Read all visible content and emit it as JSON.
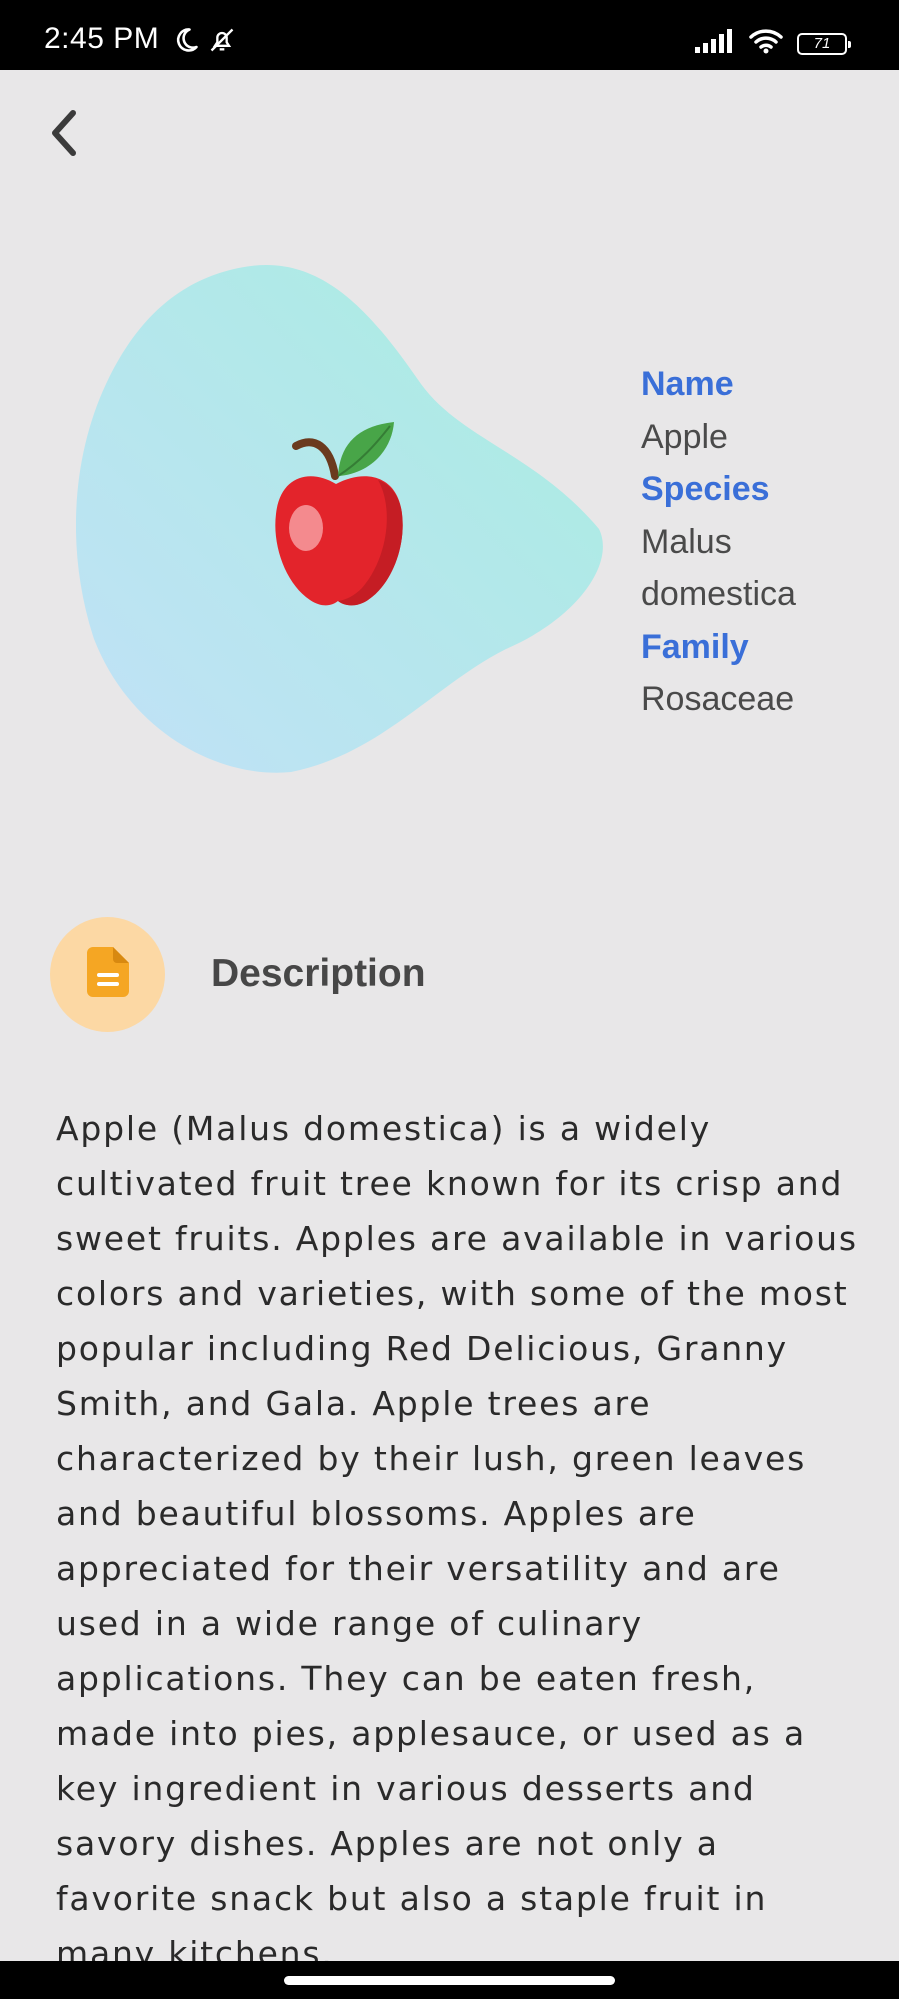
{
  "status_bar": {
    "time": "2:45 PM",
    "battery_level": "71",
    "icons": [
      "moon-icon",
      "bell-off-icon",
      "signal-icon",
      "wifi-icon",
      "battery-icon"
    ]
  },
  "header": {
    "back_icon": "chevron-left-icon"
  },
  "hero": {
    "image_icon": "apple-icon",
    "blob_colors": [
      "#a8ede0",
      "#bfe0f7"
    ]
  },
  "info": {
    "name_label": "Name",
    "name_value": "Apple",
    "species_label": "Species",
    "species_value_line1": "Malus",
    "species_value_line2": "domestica",
    "family_label": "Family",
    "family_value": "Rosaceae",
    "label_color": "#3a6fd8"
  },
  "description": {
    "icon": "document-icon",
    "icon_color": "#f5a623",
    "title": "Description",
    "text": "Apple (Malus domestica) is a widely cultivated fruit tree known for its crisp and sweet fruits. Apples are available in various colors and varieties, with some of the most popular including Red Delicious, Granny Smith, and Gala. Apple trees are characterized by their lush, green leaves and beautiful blossoms. Apples are appreciated for their versatility and are used in a wide range of culinary applications. They can be eaten fresh, made into pies, applesauce, or used as a key ingredient in various desserts and savory dishes. Apples are not only a favorite snack but also a staple fruit in many kitchens."
  }
}
